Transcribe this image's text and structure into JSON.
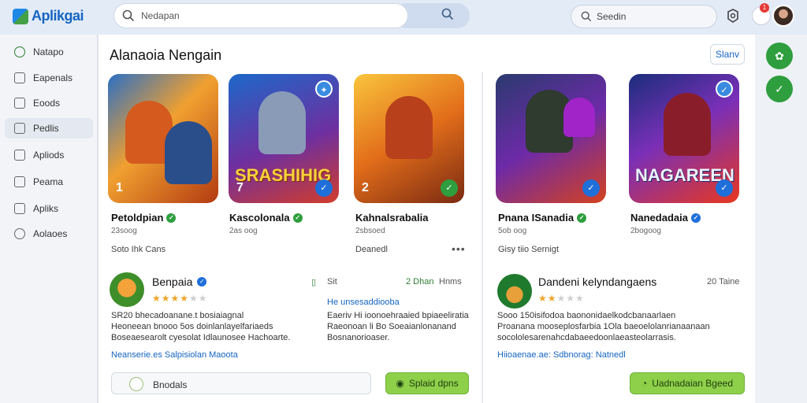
{
  "header": {
    "logo_text": "Aplikgai",
    "search_placeholder": "Nedapan",
    "search2_placeholder": "Seedin",
    "notification_count": "1"
  },
  "sidebar": {
    "items": [
      {
        "label": "Natapo"
      },
      {
        "label": "Eapenals"
      },
      {
        "label": "Eoods"
      },
      {
        "label": "Pedlis"
      },
      {
        "label": "Apliods"
      },
      {
        "label": "Peama"
      },
      {
        "label": "Apliks"
      },
      {
        "label": "Aolaoes"
      }
    ]
  },
  "main": {
    "title": "Alanaoia Nengain",
    "share_label": "Slanv",
    "cards": [
      {
        "num": "1",
        "overlay": "",
        "title": "Petoldpian",
        "sub": "23soog"
      },
      {
        "num": "7",
        "overlay": "SRASHIHIG",
        "title": "Kascolonala",
        "sub": "2as oog"
      },
      {
        "num": "2",
        "overlay": "",
        "title": "Kahnalsrabalia",
        "sub": "2sbsoed"
      },
      {
        "num": "",
        "overlay": "",
        "title": "Pnana ISanadia",
        "sub": "5ob oog"
      },
      {
        "num": "",
        "overlay": "NAGAREEN",
        "title": "Nanedadaia",
        "sub": "2bogoog"
      }
    ],
    "row_meta_left": "Soto Ihk Cans",
    "row_meta_mid": "Deanedl",
    "row_meta_right": "Gisy tiio Sernigt",
    "review1": {
      "name": "Benpaia",
      "text": "SR20 bhecadoanane.t bosiaiagnal\nHeoneean bnooo 5os doinlanlayelfariaeds\nBoseaesearolt cyesolat Idlaunosee Hachoarte.",
      "link": "Neanserie.es Salpisiolan Maoota",
      "meta_a": "Sit",
      "meta_b": "2 Dhan",
      "meta_c": "Hnms",
      "col2_head": "He unsesaddiooba",
      "col2_text": "Eaeriv Hi ioonoehraaied bpiaeeliratia\nRaeonoan li Bo Soeaianlonanand\nBosnanorioaser."
    },
    "review2": {
      "name": "Dandeni kelyndangaens",
      "meta": "20 Taine",
      "text": "Sooo 150isifodoa baononidaelkodcbanaarlaen\nProanana mooseplosfarbia 1Ola baeoelolanrianaanaan\nsocololesarenahcdabaeedoonlaeasteolarrasis.",
      "link": "Hiioaenae.ae: Sdbnorag: Natnedl"
    },
    "action1_input": "Bnodals",
    "action1_button": "Splaid dpns",
    "action2_button": "Uadnadaian Bgeed"
  }
}
